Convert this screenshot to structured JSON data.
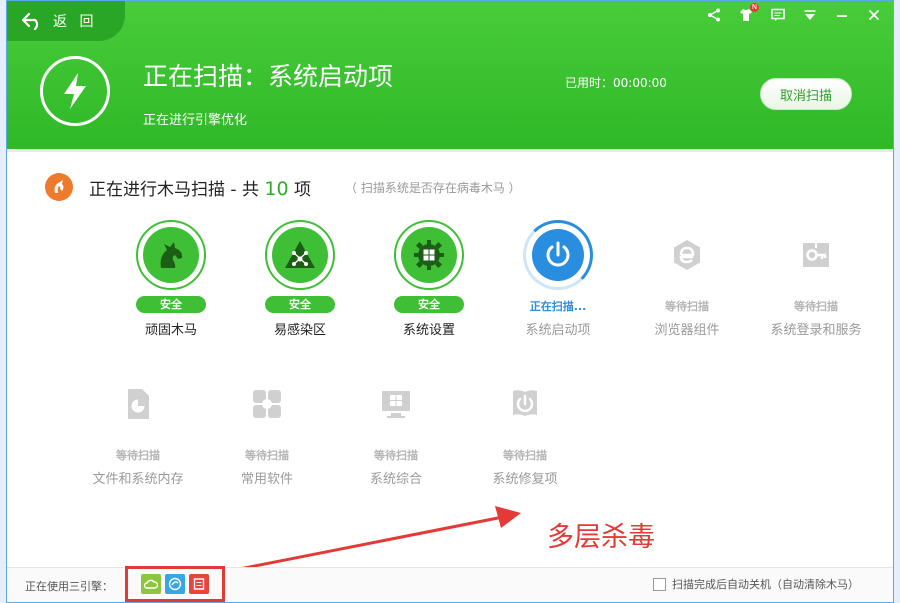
{
  "colors": {
    "brand_green": "#2fb828",
    "scan_blue": "#2a8ee0",
    "waiting_grey": "#c8c8c8",
    "annotation_red": "#e53935"
  },
  "nav": {
    "back_label": "返 回"
  },
  "controls": [
    "share-icon",
    "shirt-skin-icon",
    "chat-icon",
    "menu-down-icon",
    "minimize-icon",
    "close-icon"
  ],
  "notif": {
    "count": "N"
  },
  "header": {
    "title": "正在扫描：系统启动项",
    "subtitle": "正在进行引擎优化",
    "elapsed_label": "已用时：00:00:00",
    "cancel_label": "取消扫描"
  },
  "section": {
    "prefix": "正在进行木马扫描 - 共 ",
    "count": "10",
    "suffix": " 项",
    "hint": "（ 扫描系统是否存在病毒木马 ）"
  },
  "items": [
    {
      "status": "安全",
      "label": "顽固木马",
      "state": "safe",
      "icon": "horse-icon"
    },
    {
      "status": "安全",
      "label": "易感染区",
      "state": "safe",
      "icon": "network-triangle-icon"
    },
    {
      "status": "安全",
      "label": "系统设置",
      "state": "safe",
      "icon": "windows-gear-icon"
    },
    {
      "status": "正在扫描...",
      "label": "系统启动项",
      "state": "scanning",
      "icon": "power-icon"
    },
    {
      "status": "等待扫描",
      "label": "浏览器组件",
      "state": "waiting",
      "icon": "browser-e-icon"
    },
    {
      "status": "等待扫描",
      "label": "系统登录和服务",
      "state": "waiting",
      "icon": "key-login-icon"
    },
    {
      "status": "等待扫描",
      "label": "文件和系统内存",
      "state": "waiting",
      "icon": "file-memory-icon"
    },
    {
      "status": "等待扫描",
      "label": "常用软件",
      "state": "waiting",
      "icon": "software-icon"
    },
    {
      "status": "等待扫描",
      "label": "系统综合",
      "state": "waiting",
      "icon": "system-windows-icon"
    },
    {
      "status": "等待扫描",
      "label": "系统修复项",
      "state": "waiting",
      "icon": "repair-icon"
    }
  ],
  "annotation": {
    "text": "多层杀毒"
  },
  "footer": {
    "engines_label": "正在使用三引擎：",
    "engines": [
      "cloud-engine-icon",
      "qvm-engine-icon",
      "avira-engine-icon"
    ],
    "auto_shutdown_label": "扫描完成后自动关机（自动清除木马）"
  }
}
